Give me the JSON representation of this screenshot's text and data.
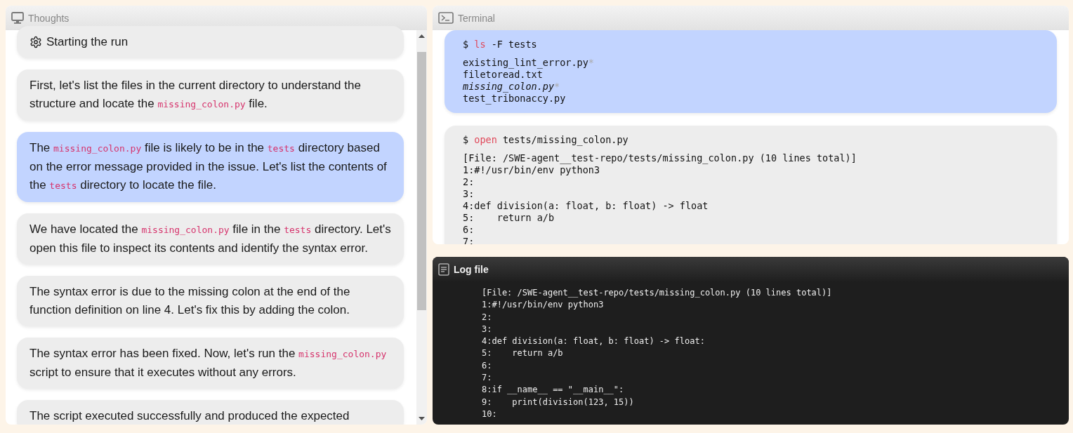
{
  "thoughts": {
    "title": "Thoughts",
    "items": [
      {
        "kind": "step",
        "selected": false,
        "parts": [
          {
            "kind": "text",
            "text": "Starting the run"
          }
        ]
      },
      {
        "kind": "message",
        "selected": false,
        "parts": [
          {
            "kind": "text",
            "text": "First, let's list the files in the current directory to understand the structure and locate the "
          },
          {
            "kind": "code",
            "text": "missing_colon.py"
          },
          {
            "kind": "text",
            "text": " file."
          }
        ]
      },
      {
        "kind": "message",
        "selected": true,
        "parts": [
          {
            "kind": "text",
            "text": "The "
          },
          {
            "kind": "code",
            "text": "missing_colon.py"
          },
          {
            "kind": "text",
            "text": " file is likely to be in the "
          },
          {
            "kind": "code",
            "text": "tests"
          },
          {
            "kind": "text",
            "text": " directory based on the error message provided in the issue. Let's list the contents of the "
          },
          {
            "kind": "code",
            "text": "tests"
          },
          {
            "kind": "text",
            "text": " directory to locate the file."
          }
        ]
      },
      {
        "kind": "message",
        "selected": false,
        "parts": [
          {
            "kind": "text",
            "text": "We have located the "
          },
          {
            "kind": "code",
            "text": "missing_colon.py"
          },
          {
            "kind": "text",
            "text": " file in the "
          },
          {
            "kind": "code",
            "text": "tests"
          },
          {
            "kind": "text",
            "text": " directory. Let's open this file to inspect its contents and identify the syntax error."
          }
        ]
      },
      {
        "kind": "message",
        "selected": false,
        "parts": [
          {
            "kind": "text",
            "text": "The syntax error is due to the missing colon at the end of the function definition on line 4. Let's fix this by adding the colon."
          }
        ]
      },
      {
        "kind": "message",
        "selected": false,
        "parts": [
          {
            "kind": "text",
            "text": "The syntax error has been fixed. Now, let's run the "
          },
          {
            "kind": "code",
            "text": "missing_colon.py"
          },
          {
            "kind": "text",
            "text": " script to ensure that it executes without any errors."
          }
        ]
      },
      {
        "kind": "message",
        "selected": false,
        "parts": [
          {
            "kind": "text",
            "text": "The script executed successfully and produced the expected"
          }
        ]
      }
    ]
  },
  "terminal": {
    "title": "Terminal",
    "blocks": [
      {
        "selected": true,
        "prompt": "$",
        "command": "ls",
        "args": "-F tests",
        "output": [
          [
            {
              "kind": "plain",
              "text": "existing_lint_error.py"
            },
            {
              "kind": "mark",
              "text": "*"
            }
          ],
          [
            {
              "kind": "plain",
              "text": "filetoread.txt"
            }
          ],
          [
            {
              "kind": "italic",
              "text": "missing_colon.py"
            },
            {
              "kind": "mark",
              "text": "*"
            }
          ],
          [
            {
              "kind": "plain",
              "text": "test_tribonaccy.py"
            }
          ]
        ]
      },
      {
        "selected": false,
        "prompt": "$",
        "command": "open",
        "args": "tests/missing_colon.py",
        "output": [
          [
            {
              "kind": "plain",
              "text": "[File: /SWE-agent__test-repo/tests/missing_colon.py (10 lines total)]"
            }
          ],
          [
            {
              "kind": "plain",
              "text": "1:#!/usr/bin/env python3"
            }
          ],
          [
            {
              "kind": "plain",
              "text": "2:"
            }
          ],
          [
            {
              "kind": "plain",
              "text": "3:"
            }
          ],
          [
            {
              "kind": "plain",
              "text": "4:def division(a: float, b: float) -> float"
            }
          ],
          [
            {
              "kind": "plain",
              "text": "5:    return a/b"
            }
          ],
          [
            {
              "kind": "plain",
              "text": "6:"
            }
          ],
          [
            {
              "kind": "plain",
              "text": "7:"
            }
          ]
        ]
      }
    ]
  },
  "log": {
    "title": "Log file",
    "lines": [
      "[File: /SWE-agent__test-repo/tests/missing_colon.py (10 lines total)]",
      "1:#!/usr/bin/env python3",
      "2:",
      "3:",
      "4:def division(a: float, b: float) -> float:",
      "5:    return a/b",
      "6:",
      "7:",
      "8:if __name__ == \"__main__\":",
      "9:    print(division(123, 15))",
      "10:"
    ]
  }
}
